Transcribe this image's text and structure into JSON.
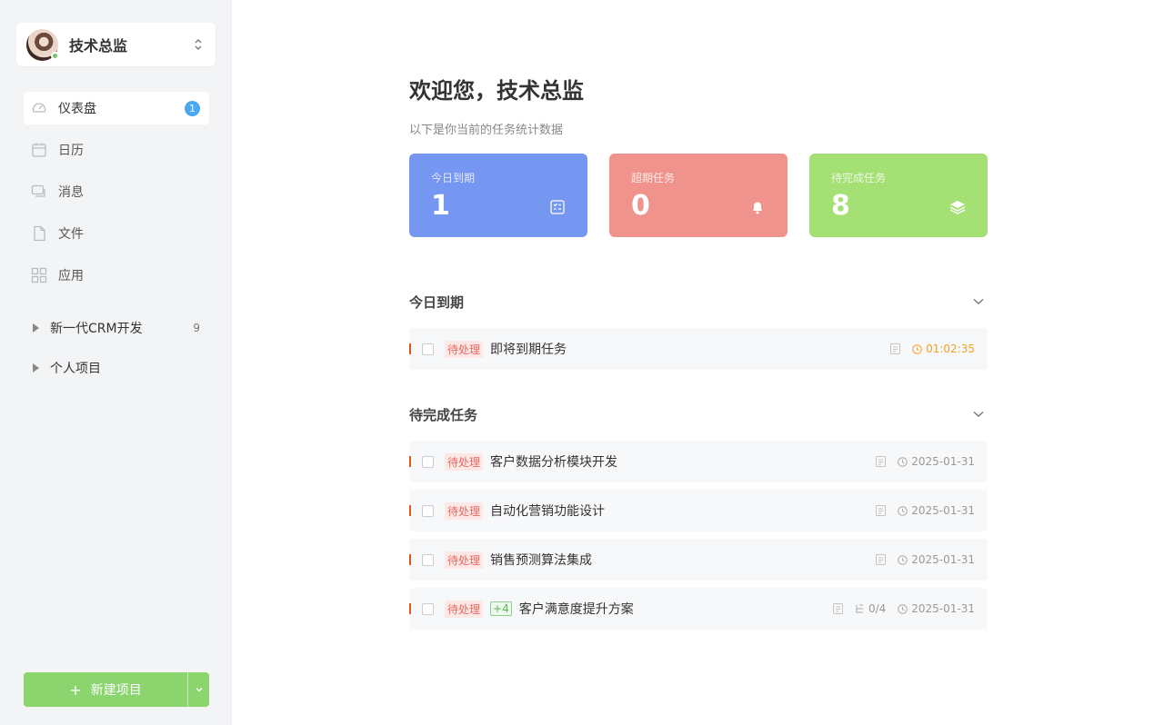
{
  "user": {
    "name": "技术总监"
  },
  "nav": [
    {
      "label": "仪表盘",
      "icon": "dashboard-icon",
      "badge": "1",
      "active": true
    },
    {
      "label": "日历",
      "icon": "calendar-icon"
    },
    {
      "label": "消息",
      "icon": "message-icon"
    },
    {
      "label": "文件",
      "icon": "file-icon"
    },
    {
      "label": "应用",
      "icon": "apps-icon"
    }
  ],
  "projects": [
    {
      "label": "新一代CRM开发",
      "count": "9"
    },
    {
      "label": "个人项目",
      "count": ""
    }
  ],
  "new_project_label": "新建项目",
  "main": {
    "welcome": "欢迎您，技术总监",
    "subtitle": "以下是你当前的任务统计数据",
    "stats": [
      {
        "label": "今日到期",
        "value": "1",
        "icon": "checklist-icon",
        "color": "#7596f1"
      },
      {
        "label": "超期任务",
        "value": "0",
        "icon": "bell-icon",
        "color": "#f0938c"
      },
      {
        "label": "待完成任务",
        "value": "8",
        "icon": "layers-icon",
        "color": "#a4e074"
      }
    ],
    "section_today": "今日到期",
    "section_pending": "待完成任务",
    "today_tasks": [
      {
        "status": "待处理",
        "name": "即将到期任务",
        "due": "01:02:35"
      }
    ],
    "pending_tasks": [
      {
        "status": "待处理",
        "name": "客户数据分析模块开发",
        "due": "2025-01-31"
      },
      {
        "status": "待处理",
        "name": "自动化营销功能设计",
        "due": "2025-01-31"
      },
      {
        "status": "待处理",
        "name": "销售预测算法集成",
        "due": "2025-01-31"
      },
      {
        "status": "待处理",
        "extra": "+4",
        "name": "客户满意度提升方案",
        "subtasks": "0/4",
        "due": "2025-01-31"
      }
    ]
  }
}
